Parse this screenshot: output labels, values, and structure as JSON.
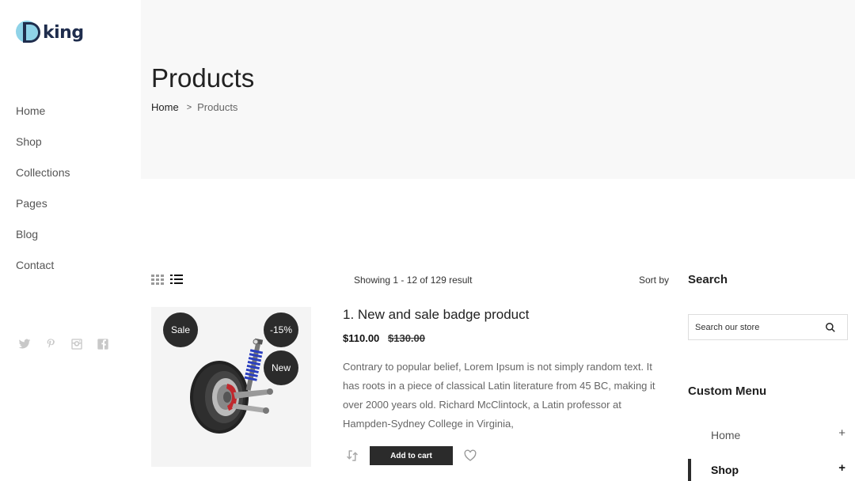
{
  "brand": {
    "name": "king"
  },
  "nav": {
    "items": [
      {
        "label": "Home"
      },
      {
        "label": "Shop"
      },
      {
        "label": "Collections"
      },
      {
        "label": "Pages"
      },
      {
        "label": "Blog"
      },
      {
        "label": "Contact"
      }
    ]
  },
  "social": [
    "twitter-icon",
    "pinterest-icon",
    "instagram-icon",
    "facebook-icon"
  ],
  "header": {
    "title": "Products",
    "breadcrumb": {
      "home": "Home",
      "separator": ">",
      "current": "Products"
    }
  },
  "toolbar": {
    "showing": "Showing 1 - 12 of 129 result",
    "sort_label": "Sort by"
  },
  "product": {
    "title": "1. New and sale badge product",
    "price": "$110.00",
    "old_price": "$130.00",
    "badges": {
      "sale": "Sale",
      "discount": "-15%",
      "new": "New"
    },
    "description": "Contrary to popular belief, Lorem Ipsum is not simply random text. It has roots in a piece of classical Latin literature from 45 BC, making it over 2000 years old. Richard McClintock, a Latin professor at Hampden-Sydney College in Virginia,",
    "add_to_cart": "Add to cart"
  },
  "sidebar": {
    "search_title": "Search",
    "search_placeholder": "Search our store",
    "menu_title": "Custom Menu",
    "menu": [
      {
        "label": "Home",
        "toggle": "+"
      },
      {
        "label": "Shop",
        "toggle": "+"
      }
    ]
  },
  "colors": {
    "accent": "#2b2b2b",
    "banner_bg": "#f8f8f8",
    "logo_blue": "#8fd3e8",
    "logo_navy": "#1f2d4d"
  }
}
